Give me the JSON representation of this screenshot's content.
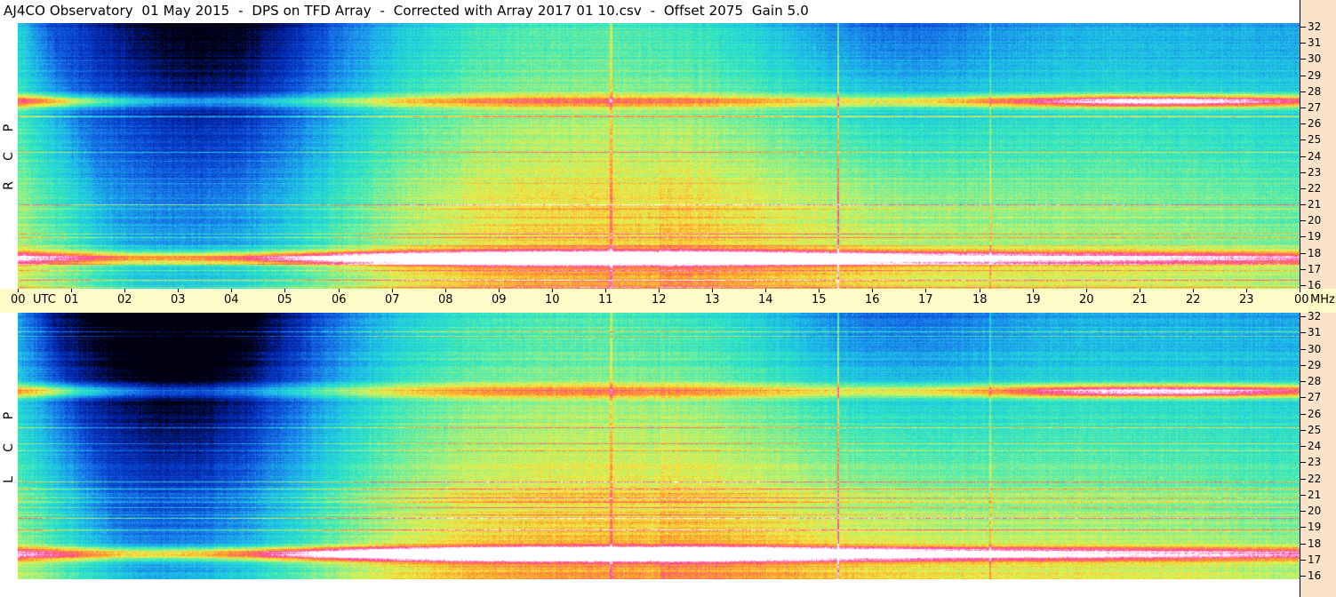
{
  "title": "AJ4CO Observatory  01 May 2015  -  DPS on TFD Array  -  Corrected with Array 2017 01 10.csv  -  Offset 2075  Gain 5.0",
  "chart_data": [
    {
      "type": "heatmap",
      "panel": "RCP",
      "polarization_label": [
        "R",
        "C",
        "P"
      ],
      "x_axis": {
        "unit_label": "UTC",
        "range": [
          0,
          24
        ],
        "tick_labels": [
          "00",
          "01",
          "02",
          "03",
          "04",
          "05",
          "06",
          "07",
          "08",
          "09",
          "10",
          "11",
          "12",
          "13",
          "14",
          "15",
          "16",
          "17",
          "18",
          "19",
          "20",
          "21",
          "22",
          "23",
          "00"
        ]
      },
      "y_axis": {
        "unit_label": "MHz",
        "range": [
          16,
          32
        ],
        "tick_labels": [
          "32",
          "31",
          "30",
          "29",
          "28",
          "27",
          "26",
          "25",
          "24",
          "23",
          "22",
          "21",
          "20",
          "19",
          "18",
          "17",
          "16"
        ]
      },
      "colormap": [
        "#000010",
        "#001e9b",
        "#0a46d2",
        "#1a82eb",
        "#1ec3e6",
        "#2de6c3",
        "#8cf08c",
        "#f0f046",
        "#ff9628",
        "#ff3ca0",
        "#ffffff"
      ],
      "features": {
        "interference_bands_mhz": [
          27.3,
          17.8
        ],
        "vertical_lines_utc": [
          15.35,
          11.1,
          18.2
        ],
        "dark_region_utc": [
          1.8,
          5.5
        ]
      }
    },
    {
      "type": "heatmap",
      "panel": "LCP",
      "polarization_label": [
        "L",
        "C",
        "P"
      ],
      "x_axis": {
        "unit_label": "UTC",
        "range": [
          0,
          24
        ]
      },
      "y_axis": {
        "unit_label": "MHz",
        "range": [
          16,
          32
        ],
        "tick_labels": [
          "32",
          "31",
          "30",
          "29",
          "28",
          "27",
          "26",
          "25",
          "24",
          "23",
          "22",
          "21",
          "20",
          "19",
          "18",
          "17",
          "16"
        ]
      },
      "features": {
        "interference_bands_mhz": [
          27.3,
          17.5
        ],
        "vertical_lines_utc": [
          15.35,
          11.1,
          18.2
        ],
        "dark_region_utc": [
          1.2,
          5.0
        ]
      }
    }
  ],
  "axis_text": {
    "utc": "UTC",
    "mhz": "MHz"
  }
}
